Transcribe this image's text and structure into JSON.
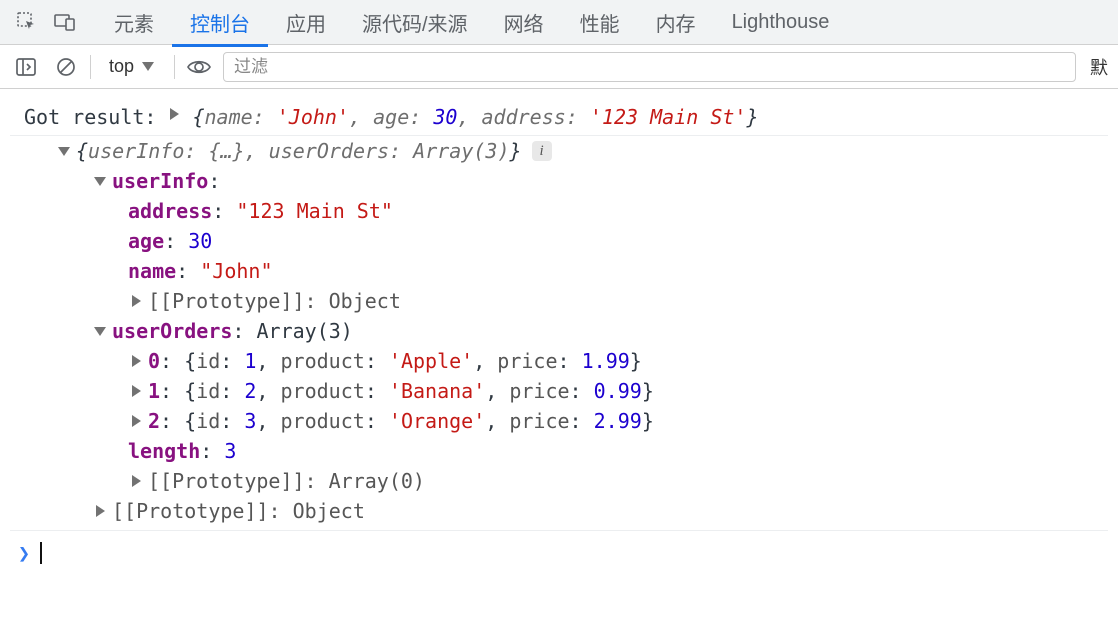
{
  "tabs": [
    "元素",
    "控制台",
    "应用",
    "源代码/来源",
    "网络",
    "性能",
    "内存",
    "Lighthouse"
  ],
  "active_tab_index": 1,
  "subbar": {
    "context": "top",
    "filter_placeholder": "过滤",
    "right_truncated": "默"
  },
  "console": {
    "line1": {
      "prefix": "Got result: ",
      "summary": {
        "open": "{",
        "entries": [
          {
            "k": "name",
            "v": "'John'",
            "t": "str"
          },
          {
            "k": "age",
            "v": "30",
            "t": "num"
          },
          {
            "k": "address",
            "v": "'123 Main St'",
            "t": "str"
          }
        ],
        "close": "}"
      }
    },
    "obj": {
      "summary": "{userInfo: {…}, userOrders: Array(3)}",
      "userInfo": {
        "label": "userInfo",
        "props": [
          {
            "k": "address",
            "v": "\"123 Main St\"",
            "t": "str"
          },
          {
            "k": "age",
            "v": "30",
            "t": "num"
          },
          {
            "k": "name",
            "v": "\"John\"",
            "t": "str"
          }
        ],
        "proto": "[[Prototype]]: Object"
      },
      "userOrders": {
        "label": "userOrders",
        "type": "Array(3)",
        "items": [
          {
            "idx": "0",
            "text": "{id: 1, product: 'Apple', price: 1.99}",
            "id": 1,
            "product": "'Apple'",
            "price": "1.99"
          },
          {
            "idx": "1",
            "text": "{id: 2, product: 'Banana', price: 0.99}",
            "id": 2,
            "product": "'Banana'",
            "price": "0.99"
          },
          {
            "idx": "2",
            "text": "{id: 3, product: 'Orange', price: 2.99}",
            "id": 3,
            "product": "'Orange'",
            "price": "2.99"
          }
        ],
        "length_label": "length",
        "length": "3",
        "proto": "[[Prototype]]: Array(0)"
      },
      "proto": "[[Prototype]]: Object"
    }
  },
  "info_badge": "i"
}
